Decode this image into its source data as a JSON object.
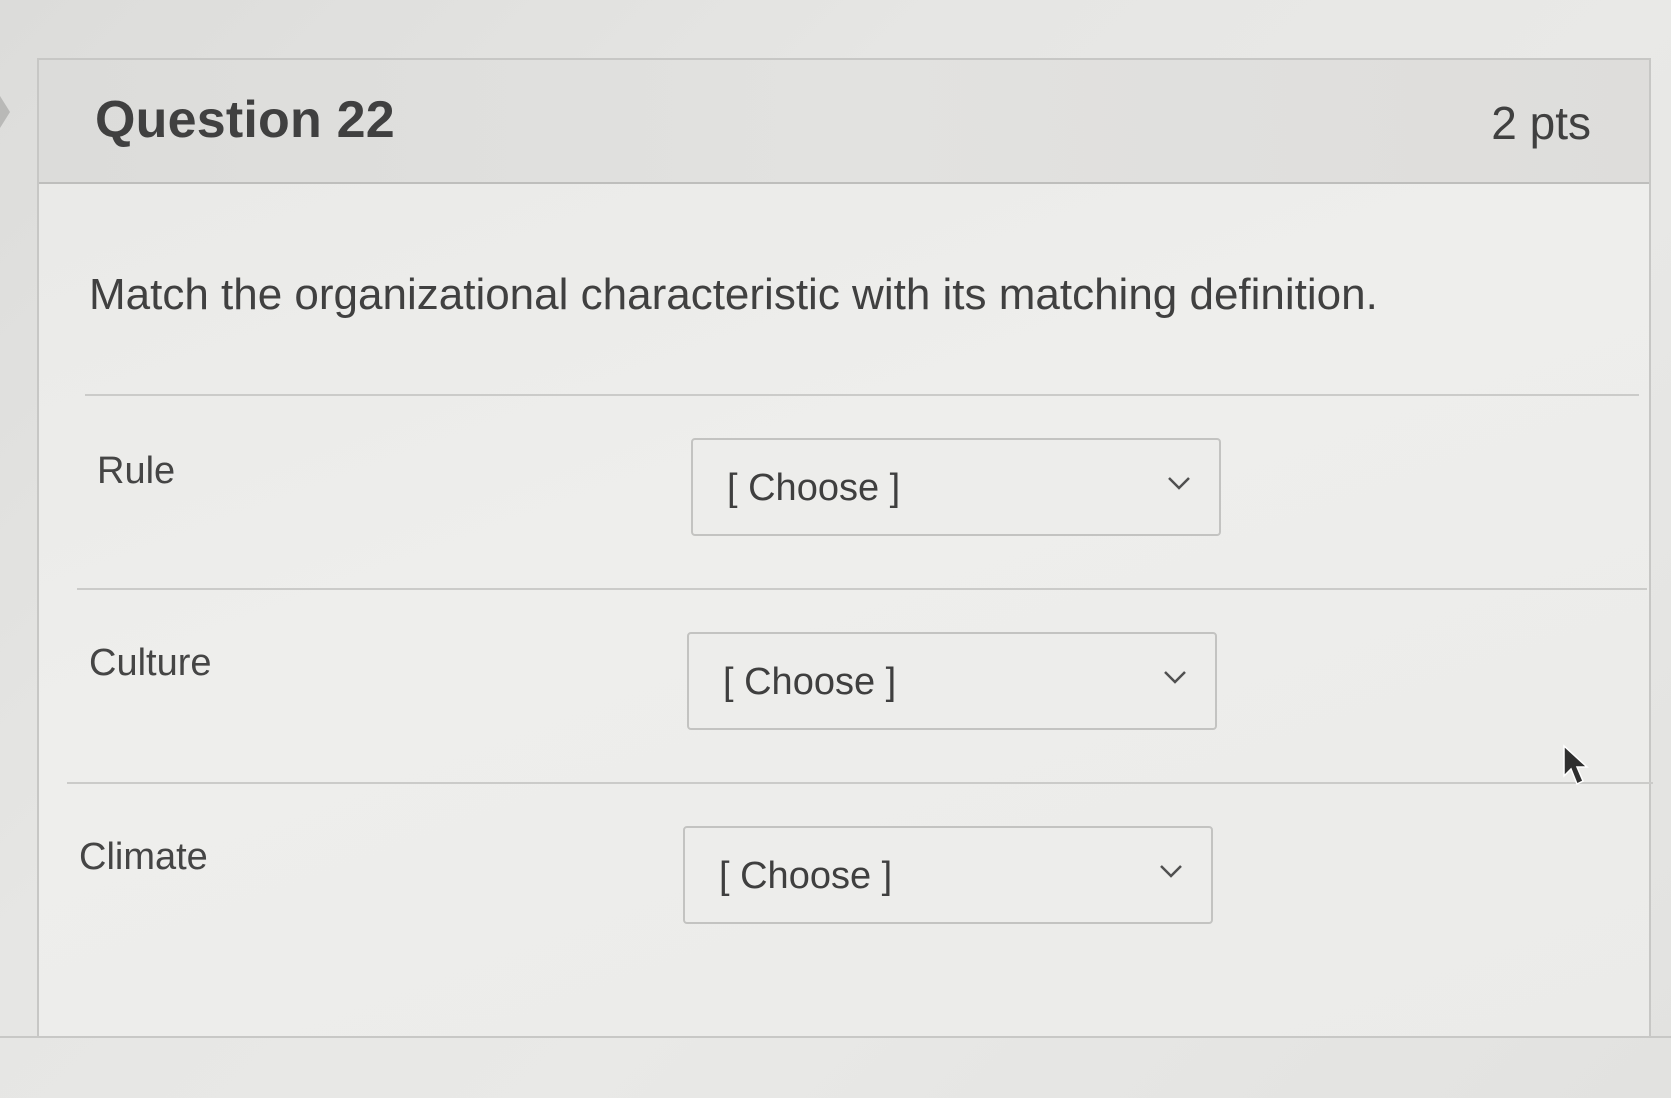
{
  "question": {
    "title": "Question 22",
    "points": "2 pts",
    "prompt": "Match the organizational characteristic with its matching definition."
  },
  "matches": [
    {
      "label": "Rule",
      "selected": "[ Choose ]"
    },
    {
      "label": "Culture",
      "selected": "[ Choose ]"
    },
    {
      "label": "Climate",
      "selected": "[ Choose ]"
    }
  ],
  "icons": {
    "dropdown": "chevron-down-icon",
    "pointer": "mouse-cursor-icon",
    "nav": "left-arrow-icon"
  },
  "colors": {
    "background": "#e8e8e6",
    "header": "#dfdfdd",
    "text": "#404040",
    "border": "#c3c3c1"
  }
}
